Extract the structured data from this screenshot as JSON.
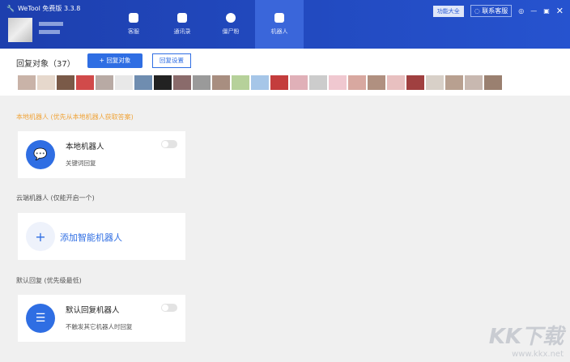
{
  "app": {
    "title": "WeTool 免费版 3.3.8"
  },
  "nav": [
    {
      "label": "客服"
    },
    {
      "label": "通讯录"
    },
    {
      "label": "僵尸粉"
    },
    {
      "label": "机器人",
      "active": true
    }
  ],
  "topright": {
    "features": "功能大全",
    "support": "联系客服"
  },
  "toolbar": {
    "reply_target": "回复对象（37）",
    "add_target": "+ 回复对象",
    "settings": "回复设置"
  },
  "sections": {
    "local": {
      "title": "本地机器人 (优先从本地机器人获取答案)",
      "card_title": "本地机器人",
      "card_sub": "关键词回复",
      "enabled": false
    },
    "cloud": {
      "title": "云端机器人 (仅能开启一个)",
      "add": "添加智能机器人"
    },
    "default": {
      "title": "默认回复 (优先级最低)",
      "card_title": "默认回复机器人",
      "card_sub": "不触发其它机器人时回复",
      "enabled": false
    }
  },
  "colors": {
    "accent": "#2f6ee3",
    "header": "#1d3fae",
    "section_orange": "#f0a43a"
  },
  "watermark": {
    "logo": "KK下载",
    "url": "www.kkx.net"
  }
}
